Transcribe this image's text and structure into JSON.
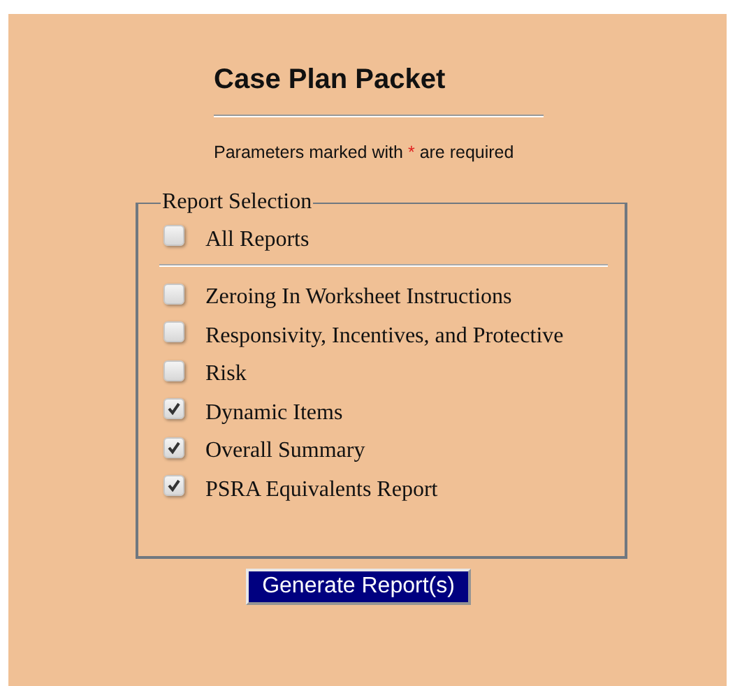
{
  "title": "Case Plan Packet",
  "note": {
    "before": "Parameters marked with",
    "marker": "*",
    "after": "are required"
  },
  "fieldset": {
    "legend": "Report Selection",
    "all": {
      "label": "All Reports",
      "checked": false
    },
    "items": [
      {
        "label": "Zeroing In Worksheet Instructions",
        "checked": false
      },
      {
        "label": "Responsivity, Incentives, and Protective",
        "checked": false
      },
      {
        "label": "Risk",
        "checked": false
      },
      {
        "label": "Dynamic Items",
        "checked": true
      },
      {
        "label": "Overall Summary",
        "checked": true
      },
      {
        "label": "PSRA Equivalents Report",
        "checked": true
      }
    ]
  },
  "button": "Generate Report(s)"
}
